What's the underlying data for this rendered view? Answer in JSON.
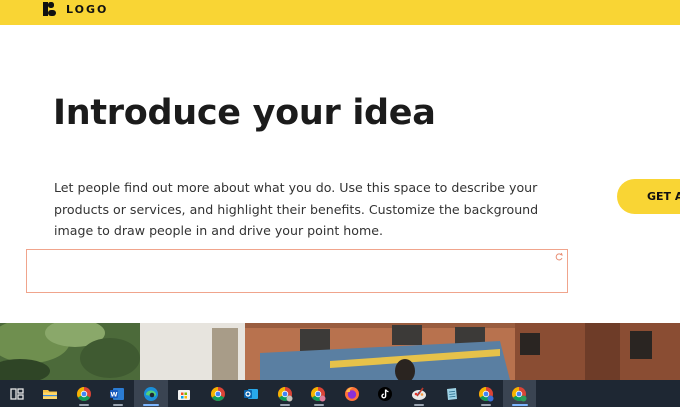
{
  "header": {
    "logo_text": "LOGO",
    "bg_color": "#f9d534"
  },
  "intro": {
    "title": "Introduce your idea",
    "body": "Let people find out more about what you do. Use this space to describe your products or services, and highlight their benefits. Customize the background image to draw people in and drive your point home."
  },
  "cta": {
    "label": "GET A"
  },
  "edit_box": {
    "border_color": "#f0a48c",
    "value": ""
  },
  "hero_image": {
    "description_icon": "hero-photo"
  },
  "taskbar": {
    "items": [
      {
        "icon": "task-view-icon"
      },
      {
        "icon": "file-explorer-icon"
      },
      {
        "icon": "chrome-icon"
      },
      {
        "icon": "word-icon"
      },
      {
        "icon": "edge-icon"
      },
      {
        "icon": "microsoft-store-icon"
      },
      {
        "icon": "chrome-icon"
      },
      {
        "icon": "outlook-icon"
      },
      {
        "icon": "chrome-profile-icon"
      },
      {
        "icon": "chrome-profile-icon"
      },
      {
        "icon": "firefox-icon"
      },
      {
        "icon": "tiktok-icon"
      },
      {
        "icon": "paint-icon"
      },
      {
        "icon": "notepad-icon"
      },
      {
        "icon": "chrome-profile-icon"
      },
      {
        "icon": "chrome-profile-icon"
      }
    ]
  }
}
